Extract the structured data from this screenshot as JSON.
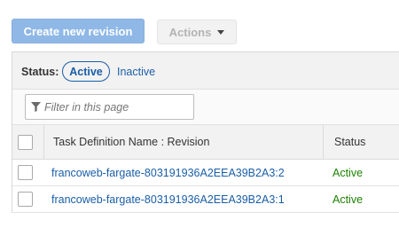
{
  "toolbar": {
    "create_label": "Create new revision",
    "actions_label": "Actions"
  },
  "status_filter": {
    "label": "Status:",
    "active_label": "Active",
    "inactive_label": "Inactive"
  },
  "filter": {
    "placeholder": "Filter in this page",
    "icon": "funnel-icon"
  },
  "table": {
    "columns": [
      "Task Definition Name : Revision",
      "Status"
    ],
    "rows": [
      {
        "name": "francoweb-fargate-803191936A2EEA39B2A3:2",
        "status": "Active"
      },
      {
        "name": "francoweb-fargate-803191936A2EEA39B2A3:1",
        "status": "Active"
      }
    ]
  },
  "colors": {
    "link": "#1a5ea8",
    "status_active": "#1d8102",
    "primary_button": "#8fb8e6"
  }
}
